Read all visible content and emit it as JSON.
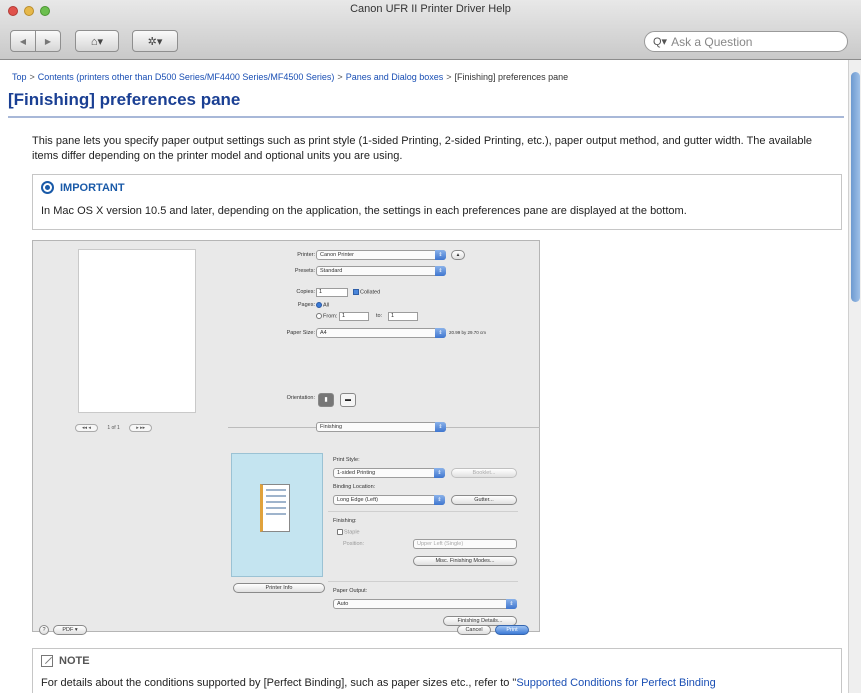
{
  "window": {
    "title": "Canon UFR II Printer Driver Help"
  },
  "toolbar": {
    "back_icon": "◀",
    "forward_icon": "▶",
    "home_icon": "⌂▾",
    "gear_icon": "✲▾",
    "search_placeholder": "Ask a Question",
    "search_icon": "Q▾"
  },
  "breadcrumb": {
    "items": [
      "Top",
      "Contents (printers other than D500 Series/MF4400 Series/MF4500 Series)",
      "Panes and Dialog boxes"
    ],
    "current": "[Finishing] preferences pane",
    "separator": ">"
  },
  "page": {
    "title": "[Finishing] preferences pane",
    "intro": "This pane lets you specify paper output settings such as print style (1-sided Printing, 2-sided Printing, etc.), paper output method, and gutter width. The available items differ depending on the printer model and optional units you are using."
  },
  "important": {
    "heading": "IMPORTANT",
    "text": "In Mac OS X version 10.5 and later, depending on the application, the settings in each preferences pane are displayed at the bottom."
  },
  "dialog": {
    "printer_label": "Printer:",
    "printer_value": "Canon Printer",
    "presets_label": "Presets:",
    "presets_value": "Standard",
    "copies_label": "Copies:",
    "copies_value": "1",
    "collated_label": "Collated",
    "pages_label": "Pages:",
    "pages_all": "All",
    "pages_from": "From:",
    "pages_from_value": "1",
    "pages_to": "to:",
    "pages_to_value": "1",
    "paper_size_label": "Paper Size:",
    "paper_size_value": "A4",
    "paper_size_dims": "20.99 by 29.70 cm",
    "orientation_label": "Orientation:",
    "pane_select": "Finishing",
    "page_counter": "1 of 1",
    "print_style_label": "Print Style:",
    "print_style_value": "1-sided Printing",
    "booklet_button": "Booklet...",
    "binding_location_label": "Binding Location:",
    "binding_location_value": "Long Edge (Left)",
    "gutter_button": "Gutter...",
    "finishing_label": "Finishing:",
    "staple_label": "Staple",
    "position_label": "Position:",
    "position_value": "Upper Left (Single)",
    "misc_button": "Misc. Finishing Modes...",
    "printer_info_button": "Printer Info",
    "paper_output_label": "Paper Output:",
    "paper_output_value": "Auto",
    "finishing_details_button": "Finishing Details...",
    "help_icon": "?",
    "pdf_button": "PDF ▾",
    "cancel_button": "Cancel",
    "print_button": "Print"
  },
  "note": {
    "heading": "NOTE",
    "text_before": "For details about the conditions supported by [Perfect Binding], such as paper sizes etc., refer to \"",
    "link": "Supported Conditions for Perfect Binding"
  },
  "scrollbar": {
    "up_icon": "▲",
    "down_icon": "▼"
  }
}
